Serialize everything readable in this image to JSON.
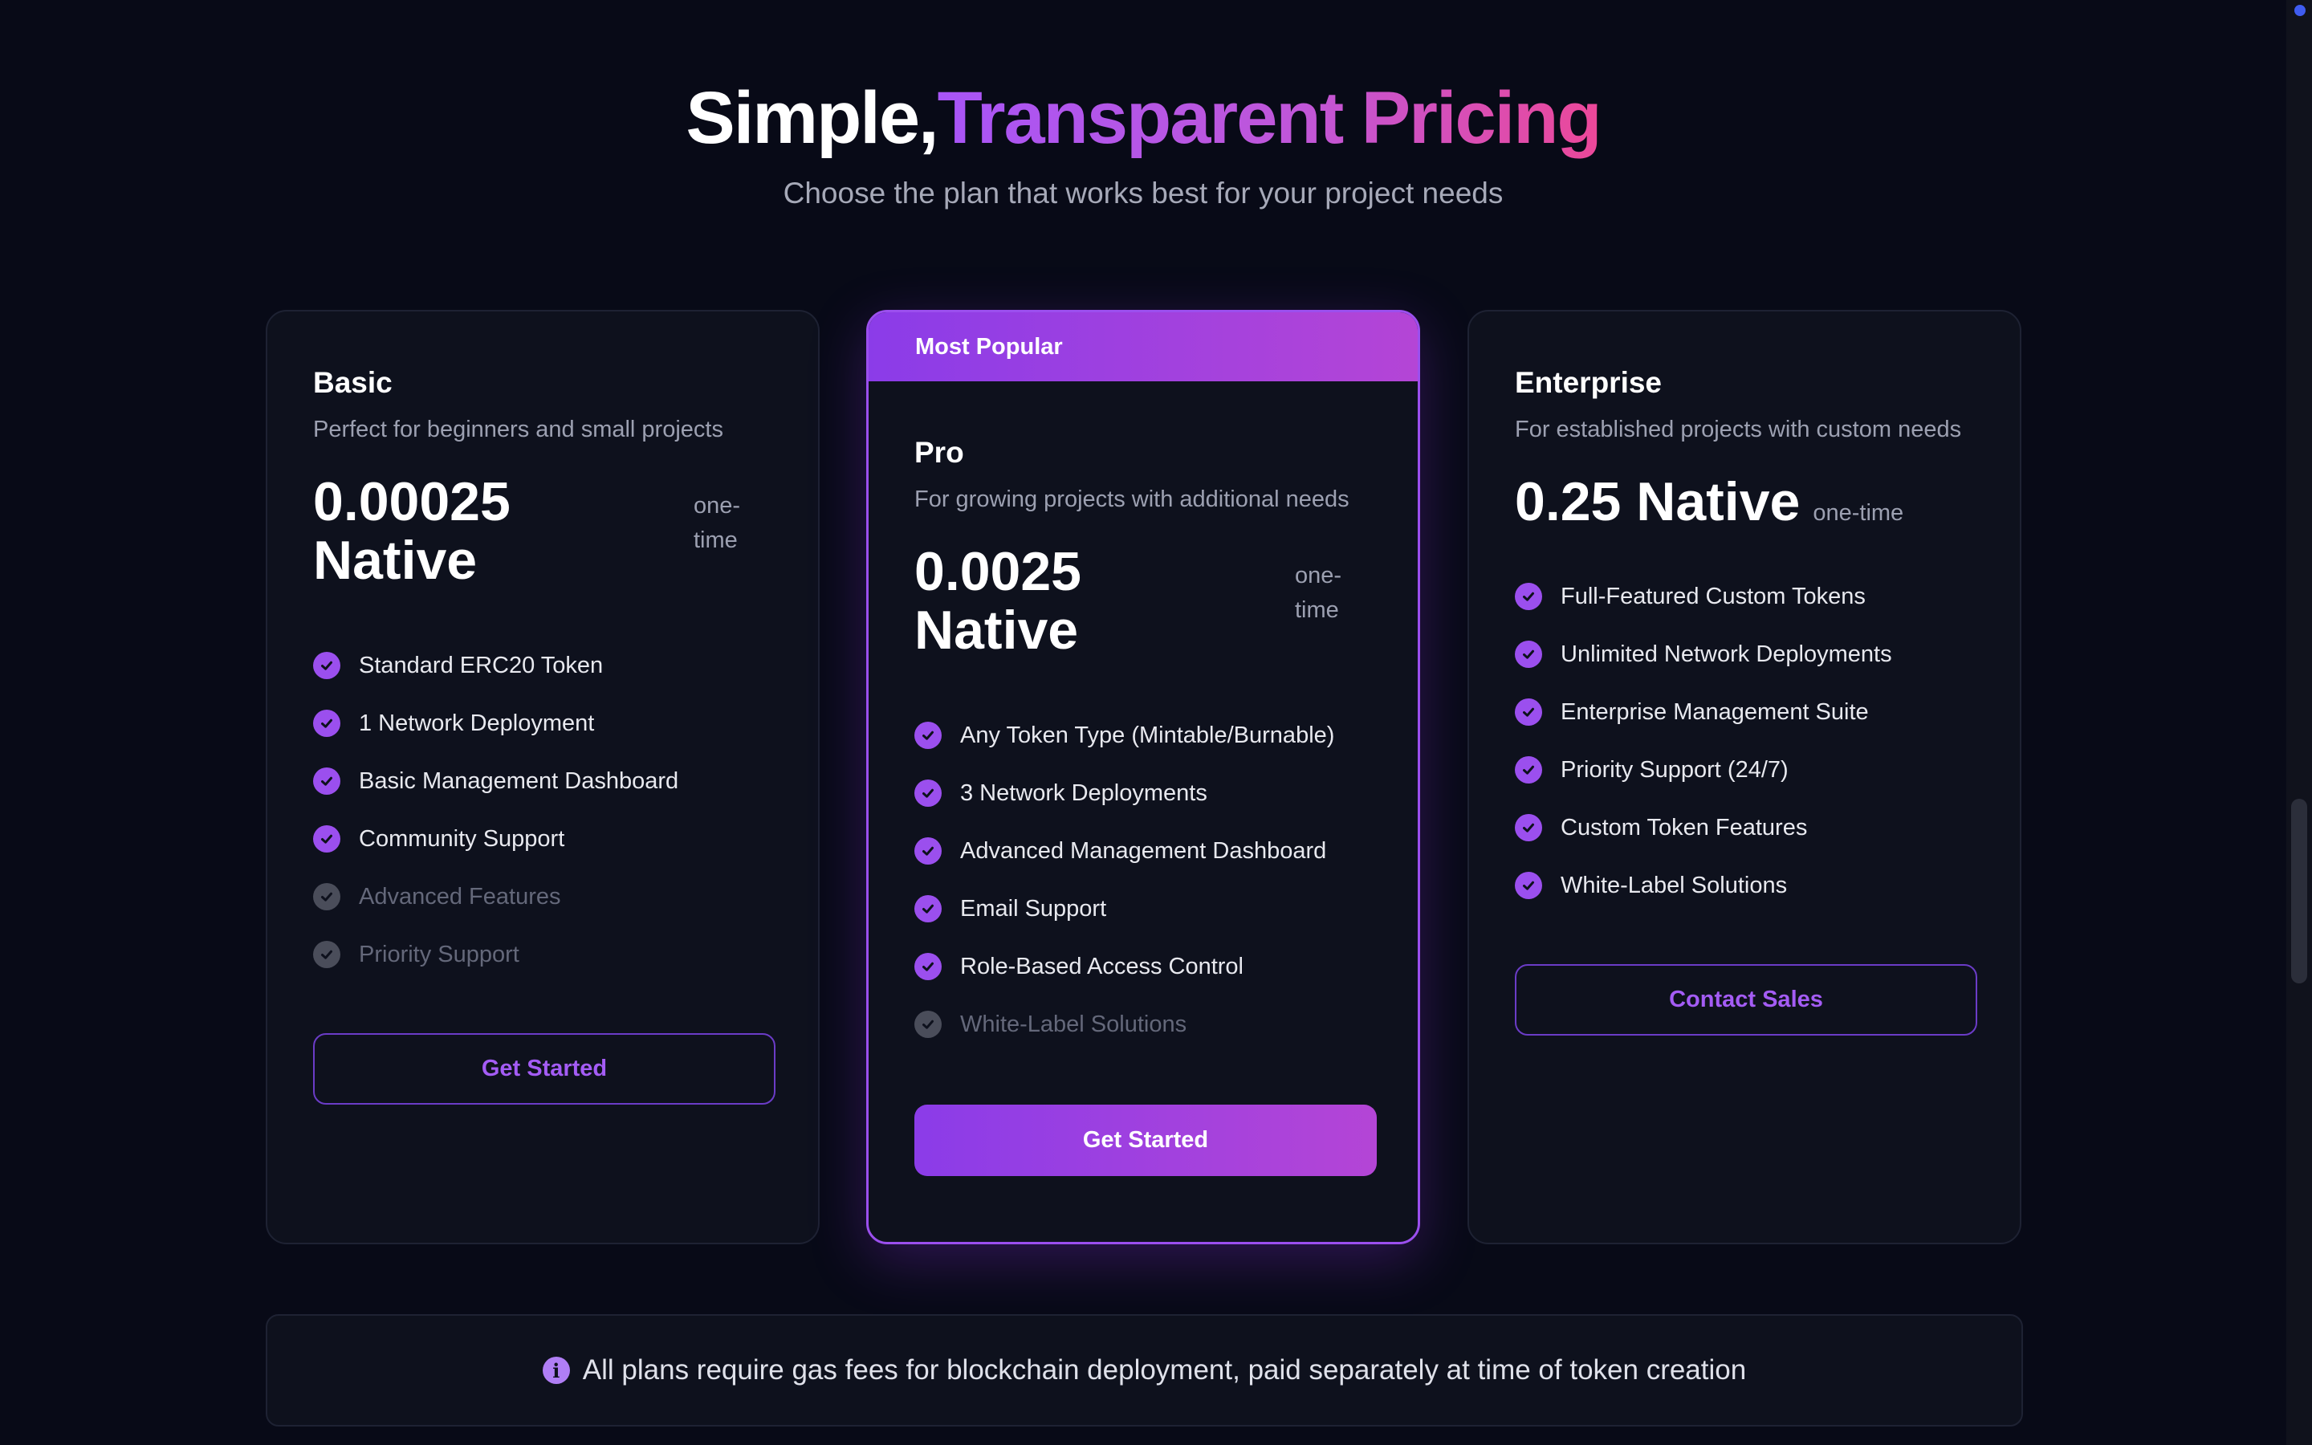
{
  "header": {
    "title_white": "Simple,",
    "title_gradient": "Transparent Pricing",
    "subtitle": "Choose the plan that works best for your project needs"
  },
  "plans": [
    {
      "name": "Basic",
      "description": "Perfect for beginners and small projects",
      "price": "0.00025 Native",
      "period": "one-time",
      "features": [
        {
          "label": "Standard ERC20 Token",
          "included": true
        },
        {
          "label": "1 Network Deployment",
          "included": true
        },
        {
          "label": "Basic Management Dashboard",
          "included": true
        },
        {
          "label": "Community Support",
          "included": true
        },
        {
          "label": "Advanced Features",
          "included": false
        },
        {
          "label": "Priority Support",
          "included": false
        }
      ],
      "button": "Get Started"
    },
    {
      "badge": "Most Popular",
      "name": "Pro",
      "description": "For growing projects with additional needs",
      "price": "0.0025 Native",
      "period": "one-time",
      "features": [
        {
          "label": "Any Token Type (Mintable/Burnable)",
          "included": true
        },
        {
          "label": "3 Network Deployments",
          "included": true
        },
        {
          "label": "Advanced Management Dashboard",
          "included": true
        },
        {
          "label": "Email Support",
          "included": true
        },
        {
          "label": "Role-Based Access Control",
          "included": true
        },
        {
          "label": "White-Label Solutions",
          "included": false
        }
      ],
      "button": "Get Started"
    },
    {
      "name": "Enterprise",
      "description": "For established projects with custom needs",
      "price": "0.25 Native",
      "period": "one-time",
      "features": [
        {
          "label": "Full-Featured Custom Tokens",
          "included": true
        },
        {
          "label": "Unlimited Network Deployments",
          "included": true
        },
        {
          "label": "Enterprise Management Suite",
          "included": true
        },
        {
          "label": "Priority Support (24/7)",
          "included": true
        },
        {
          "label": "Custom Token Features",
          "included": true
        },
        {
          "label": "White-Label Solutions",
          "included": true
        }
      ],
      "button": "Contact Sales"
    }
  ],
  "info_note": "All plans require gas fees for blockchain deployment, paid separately at time of token creation",
  "icons": {
    "feature": "check-circle-icon",
    "info": "info-icon"
  },
  "colors": {
    "accent": "#9b4fee",
    "accent_pink": "#ec4899",
    "background": "#080a17",
    "card": "#0e111d"
  }
}
